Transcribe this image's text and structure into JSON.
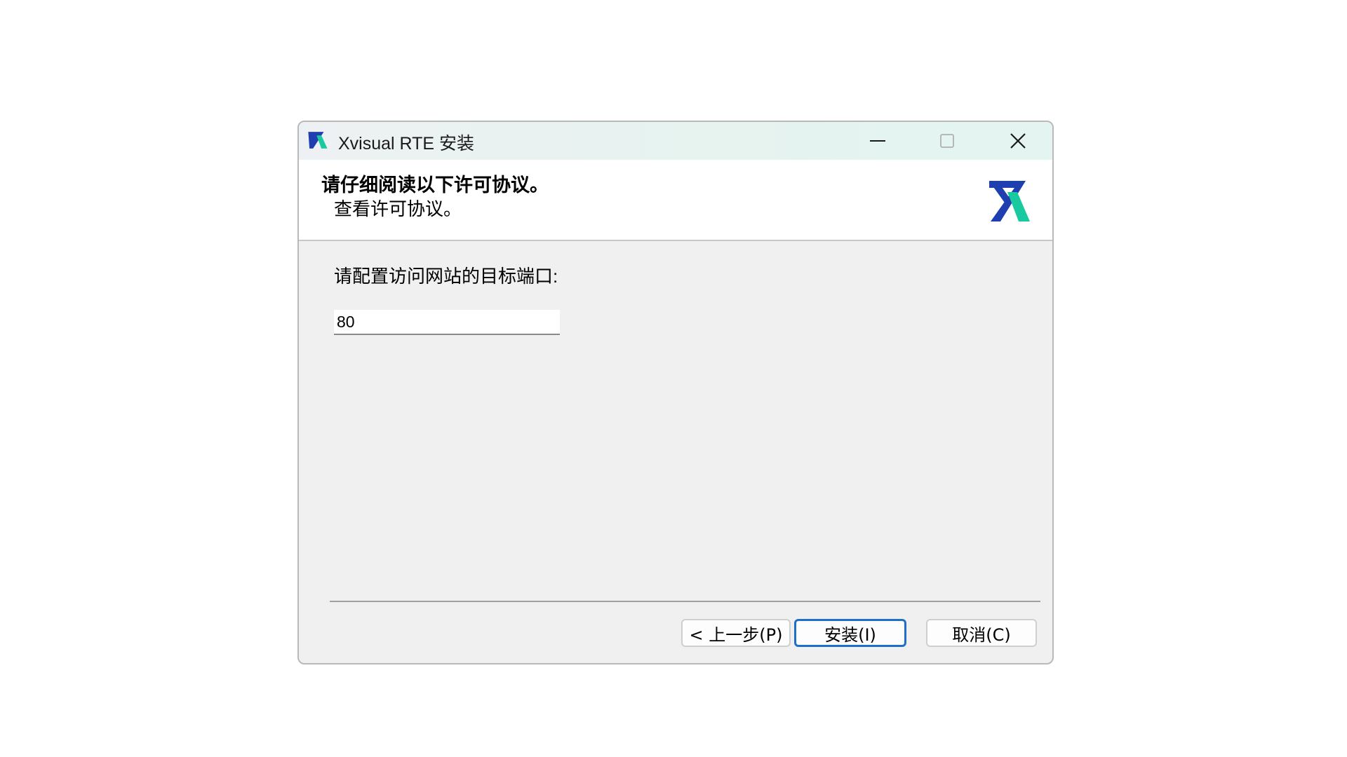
{
  "window": {
    "title": "Xvisual RTE 安装",
    "icon": "xvisual-logo-icon",
    "controls": {
      "minimize": "minimize-icon",
      "maximize": "maximize-icon",
      "close": "close-icon"
    }
  },
  "header": {
    "title": "请仔细阅读以下许可协议。",
    "subtitle": "查看许可协议。",
    "logo": "xvisual-logo"
  },
  "body": {
    "prompt": "请配置访问网站的目标端口:",
    "port_value": "80"
  },
  "buttons": {
    "back": "< 上一步(P)",
    "install": "安装(I)",
    "cancel": "取消(C)"
  },
  "colors": {
    "logo_blue": "#1f3fb0",
    "logo_green": "#19c9a0",
    "focus_blue": "#1f6fc7"
  }
}
